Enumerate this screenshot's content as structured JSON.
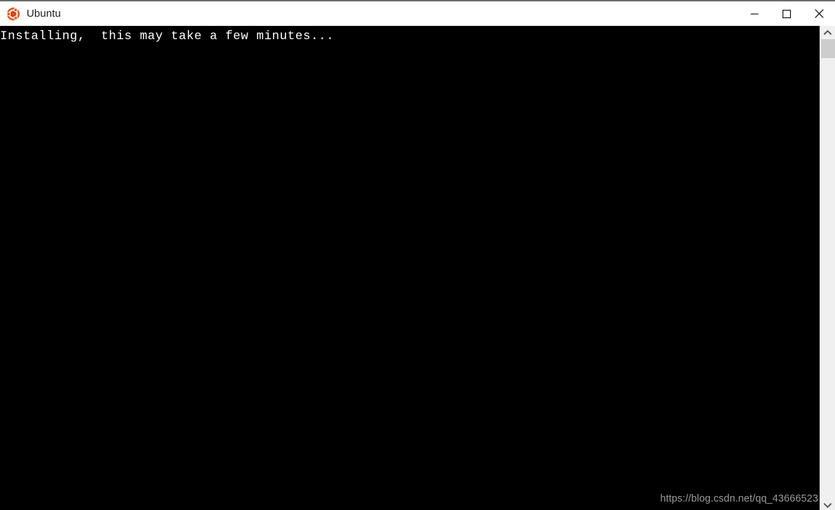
{
  "window": {
    "title": "Ubuntu",
    "app_icon": "ubuntu-logo-icon",
    "border_color": "#6b6b6b",
    "titlebar_background": "#ffffff",
    "title_color": "#1b1b1b"
  },
  "window_controls": {
    "minimize": {
      "name": "minimize-icon",
      "label": "Minimize"
    },
    "maximize": {
      "name": "maximize-icon",
      "label": "Maximize"
    },
    "close": {
      "name": "close-icon",
      "label": "Close"
    }
  },
  "terminal": {
    "background": "#000000",
    "foreground": "#ffffff",
    "lines": [
      "Installing,  this may take a few minutes..."
    ],
    "watermark": "https://blog.csdn.net/qq_43666523",
    "watermark_color": "#9a9a9a"
  },
  "scrollbar": {
    "name": "vertical-scrollbar",
    "track_color": "#f0f0f0",
    "thumb_color": "#cdcdcd",
    "up_arrow": "chevron-up-icon",
    "down_arrow": "chevron-down-icon"
  }
}
